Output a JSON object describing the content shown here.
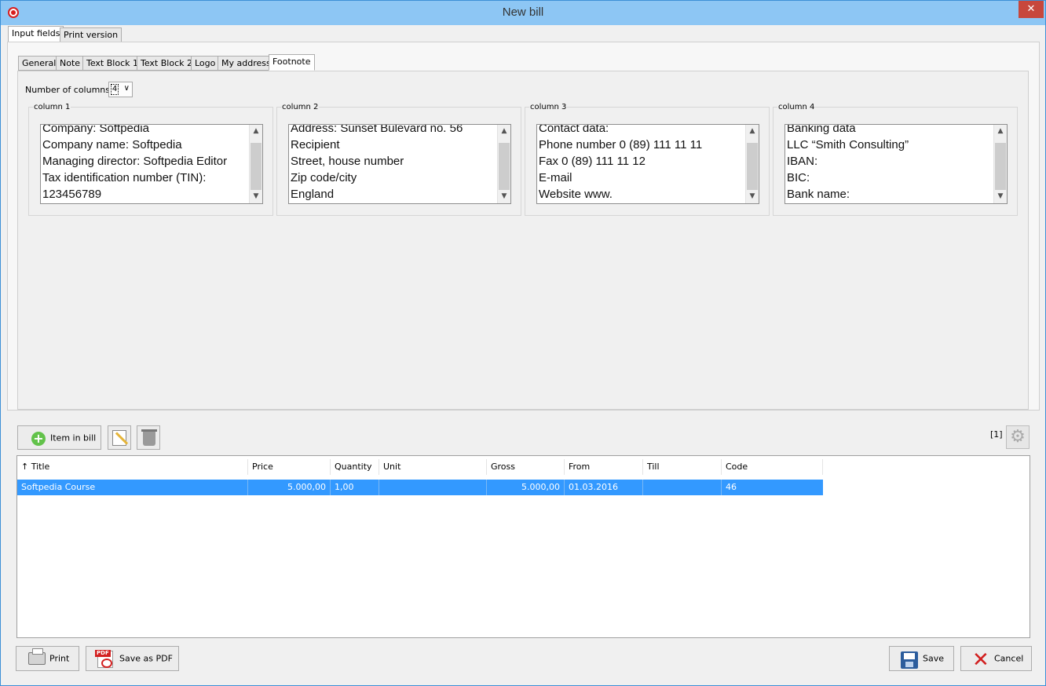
{
  "window": {
    "title": "New bill"
  },
  "top_tabs": [
    "Input fields",
    "Print version"
  ],
  "sub_tabs": [
    "General",
    "Note",
    "Text Block 1",
    "Text Block 2",
    "Logo",
    "My address",
    "Footnote"
  ],
  "footnote": {
    "columns_label": "Number of columns:",
    "columns_value": "4",
    "columns": [
      {
        "title": "column 1",
        "lines": [
          "Company: Softpedia",
          "Company name: Softpedia",
          "Managing director: Softpedia Editor",
          "Tax identification number (TIN):",
          "123456789"
        ]
      },
      {
        "title": "column 2",
        "lines": [
          "Address: Sunset Bulevard no. 56",
          "Recipient",
          "Street, house number",
          "Zip code/city",
          "England"
        ]
      },
      {
        "title": "column 3",
        "lines": [
          "Contact data:",
          "Phone number 0 (89) 111 11 11",
          "Fax 0 (89) 111 11 12",
          "E-mail",
          "Website www."
        ]
      },
      {
        "title": "column 4",
        "lines": [
          "Banking data",
          "LLC “Smith Consulting”",
          "IBAN:",
          "BIC:",
          "Bank name:"
        ]
      }
    ]
  },
  "toolbar": {
    "add_item_label": "Item in bill",
    "counter": "[1]"
  },
  "table": {
    "headers": [
      "↑ Title",
      "Price",
      "Quantity",
      "Unit",
      "Gross",
      "From",
      "Till",
      "Code"
    ],
    "rows": [
      [
        "Softpedia Course",
        "5.000,00",
        "1,00",
        "",
        "5.000,00",
        "01.03.2016",
        "",
        "46"
      ]
    ]
  },
  "buttons": {
    "print": "Print",
    "save_pdf": "Save as PDF",
    "save": "Save",
    "cancel": "Cancel"
  },
  "colors": {
    "selection": "#3399ff",
    "titlebar": "#8dc6f4",
    "close": "#c7473c"
  }
}
